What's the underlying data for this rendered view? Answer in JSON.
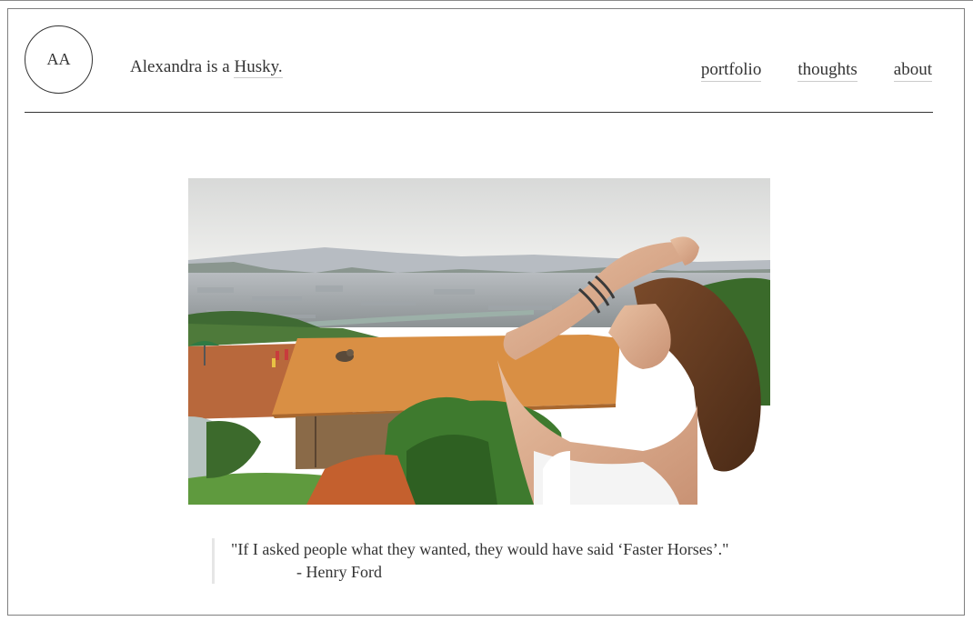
{
  "header": {
    "logo_text": "AA",
    "tagline_prefix": "Alexandra is a",
    "tagline_link": "Husky."
  },
  "nav": {
    "items": [
      {
        "label": "portfolio"
      },
      {
        "label": "thoughts"
      },
      {
        "label": "about"
      }
    ]
  },
  "hero": {
    "alt": "Woman overlooking city and mountains"
  },
  "quote": {
    "text": "\"If I asked people what they wanted, they would have said ‘Faster Horses’.\"",
    "author": "- Henry Ford"
  }
}
